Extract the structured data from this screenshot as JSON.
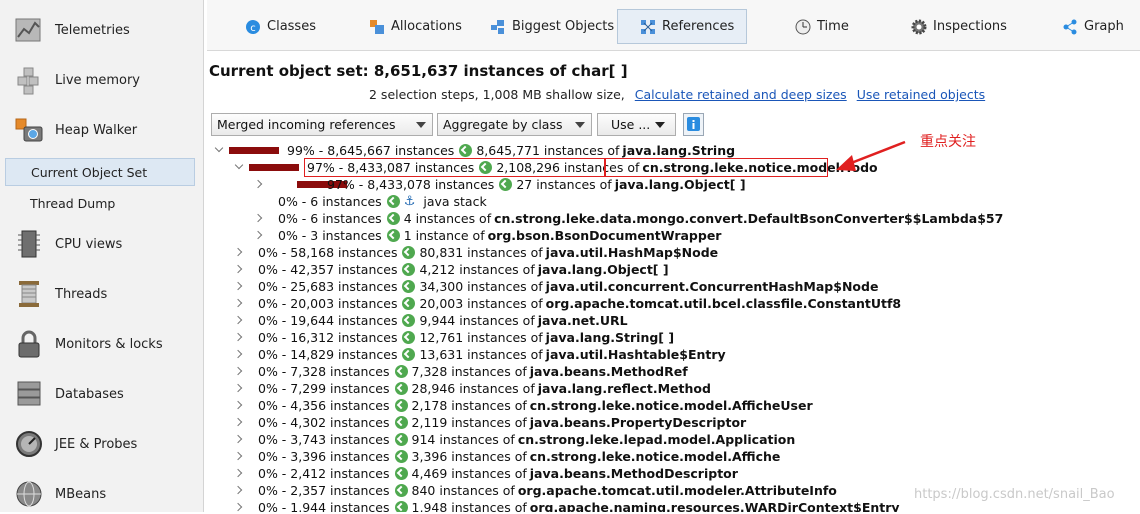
{
  "sidebar": {
    "items": [
      {
        "label": "Telemetries",
        "icon": "telemetries-icon"
      },
      {
        "label": "Live memory",
        "icon": "live-memory-icon"
      },
      {
        "label": "Heap Walker",
        "icon": "heap-walker-icon"
      },
      {
        "label": "Current Object Set",
        "icon": ""
      },
      {
        "label": "Thread Dump",
        "icon": ""
      },
      {
        "label": "CPU views",
        "icon": "cpu-views-icon"
      },
      {
        "label": "Threads",
        "icon": "threads-icon"
      },
      {
        "label": "Monitors & locks",
        "icon": "monitors-locks-icon"
      },
      {
        "label": "Databases",
        "icon": "databases-icon"
      },
      {
        "label": "JEE & Probes",
        "icon": "jee-probes-icon"
      },
      {
        "label": "MBeans",
        "icon": "mbeans-icon"
      }
    ]
  },
  "tabs": [
    {
      "label": "Classes",
      "icon": "classes-icon"
    },
    {
      "label": "Allocations",
      "icon": "allocations-icon"
    },
    {
      "label": "Biggest Objects",
      "icon": "biggest-objects-icon"
    },
    {
      "label": "References",
      "icon": "references-icon"
    },
    {
      "label": "Time",
      "icon": "time-icon"
    },
    {
      "label": "Inspections",
      "icon": "inspections-icon"
    },
    {
      "label": "Graph",
      "icon": "graph-icon"
    }
  ],
  "header": {
    "title": "Current object set:  8,651,637 instances of char[ ]",
    "subtitle": "2 selection steps, 1,008 MB shallow size,",
    "link1": "Calculate retained and deep sizes",
    "link2": "Use retained objects"
  },
  "controls": {
    "references_mode": "Merged incoming references",
    "aggregate": "Aggregate by class",
    "use": "Use ..."
  },
  "colors": {
    "bar": "#8b0c0c",
    "class_icon": "#4fa84f",
    "annotation": "#e02020",
    "link": "#1a56b8"
  },
  "tree": [
    {
      "stats": "99% - 8,645,667 instances",
      "count": "8,645,771 instances of",
      "cls": "java.lang.String"
    },
    {
      "stats": "97% - 8,433,087 instances",
      "count": "2,108,296 instances of",
      "cls": "cn.strong.leke.notice.model.Todo"
    },
    {
      "stats": "97% - 8,433,078 instances",
      "count": "27 instances of",
      "cls": "java.lang.Object[ ]"
    },
    {
      "stats": "0% - 6 instances",
      "count": "",
      "cls": "java stack"
    },
    {
      "stats": "0% - 6 instances",
      "count": "4 instances of",
      "cls": "cn.strong.leke.data.mongo.convert.DefaultBsonConverter$$Lambda$57"
    },
    {
      "stats": "0% - 3 instances",
      "count": "1 instance of",
      "cls": "org.bson.BsonDocumentWrapper"
    },
    {
      "stats": "0% - 58,168 instances",
      "count": "80,831 instances of",
      "cls": "java.util.HashMap$Node"
    },
    {
      "stats": "0% - 42,357 instances",
      "count": "4,212 instances of",
      "cls": "java.lang.Object[ ]"
    },
    {
      "stats": "0% - 25,683 instances",
      "count": "34,300 instances of",
      "cls": "java.util.concurrent.ConcurrentHashMap$Node"
    },
    {
      "stats": "0% - 20,003 instances",
      "count": "20,003 instances of",
      "cls": "org.apache.tomcat.util.bcel.classfile.ConstantUtf8"
    },
    {
      "stats": "0% - 19,644 instances",
      "count": "9,944 instances of",
      "cls": "java.net.URL"
    },
    {
      "stats": "0% - 16,312 instances",
      "count": "12,761 instances of",
      "cls": "java.lang.String[ ]"
    },
    {
      "stats": "0% - 14,829 instances",
      "count": "13,631 instances of",
      "cls": "java.util.Hashtable$Entry"
    },
    {
      "stats": "0% - 7,328 instances",
      "count": "7,328 instances of",
      "cls": "java.beans.MethodRef"
    },
    {
      "stats": "0% - 7,299 instances",
      "count": "28,946 instances of",
      "cls": "java.lang.reflect.Method"
    },
    {
      "stats": "0% - 4,356 instances",
      "count": "2,178 instances of",
      "cls": "cn.strong.leke.notice.model.AfficheUser"
    },
    {
      "stats": "0% - 4,302 instances",
      "count": "2,119 instances of",
      "cls": "java.beans.PropertyDescriptor"
    },
    {
      "stats": "0% - 3,743 instances",
      "count": "914 instances of",
      "cls": "cn.strong.leke.lepad.model.Application"
    },
    {
      "stats": "0% - 3,396 instances",
      "count": "3,396 instances of",
      "cls": "cn.strong.leke.notice.model.Affiche"
    },
    {
      "stats": "0% - 2,412 instances",
      "count": "4,469 instances of",
      "cls": "java.beans.MethodDescriptor"
    },
    {
      "stats": "0% - 2,357 instances",
      "count": "840 instances of",
      "cls": "org.apache.tomcat.util.modeler.AttributeInfo"
    },
    {
      "stats": "0% - 1,944 instances",
      "count": "1,948 instances of",
      "cls": "org.apache.naming.resources.WARDirContext$Entry"
    }
  ],
  "annotation": "重点关注",
  "watermark": "https://blog.csdn.net/snail_Bao"
}
